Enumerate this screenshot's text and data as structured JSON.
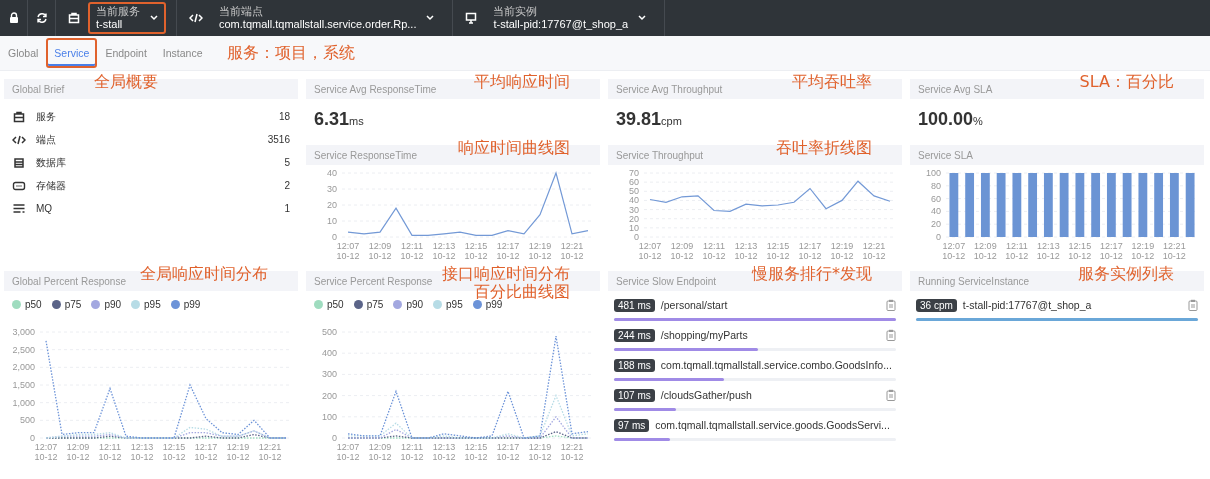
{
  "topbar": {
    "selectors": [
      {
        "kind": "service",
        "label": "当前服务",
        "value": "t-stall",
        "highlighted": true
      },
      {
        "kind": "endpoint",
        "label": "当前端点",
        "value": "com.tqmall.tqmallstall.service.order.Rp...",
        "highlighted": false
      },
      {
        "kind": "instance",
        "label": "当前实例",
        "value": "t-stall-pid:17767@t_shop_a",
        "highlighted": false
      }
    ]
  },
  "tabs": [
    {
      "label": "Global",
      "selected": false,
      "highlighted": false
    },
    {
      "label": "Service",
      "selected": true,
      "highlighted": true
    },
    {
      "label": "Endpoint",
      "selected": false,
      "highlighted": false
    },
    {
      "label": "Instance",
      "selected": false,
      "highlighted": false
    }
  ],
  "tabs_annotation": "服务：项目，系统",
  "global_brief": {
    "title": "Global Brief",
    "annotation": "全局概要",
    "items": [
      {
        "kind": "service",
        "label": "服务",
        "count": "18"
      },
      {
        "kind": "endpoint",
        "label": "端点",
        "count": "3516"
      },
      {
        "kind": "database",
        "label": "数据库",
        "count": "5"
      },
      {
        "kind": "cache",
        "label": "存储器",
        "count": "2"
      },
      {
        "kind": "mq",
        "label": "MQ",
        "count": "1"
      }
    ]
  },
  "metrics": [
    {
      "title": "Service Avg ResponseTime",
      "annotation": "平均响应时间",
      "value": "6.31",
      "unit": "ms"
    },
    {
      "title": "Service Avg Throughput",
      "annotation": "平均吞吐率",
      "value": "39.81",
      "unit": "cpm"
    },
    {
      "title": "Service Avg SLA",
      "annotation": "SLA：百分比",
      "value": "100.00",
      "unit": "%"
    }
  ],
  "trend_charts": [
    {
      "title": "Service ResponseTime",
      "annotation": "响应时间曲线图",
      "chart_data": {
        "type": "line",
        "categories": [
          "12:07 10-12",
          null,
          "12:09 10-12",
          null,
          "12:11 10-12",
          null,
          "12:13 10-12",
          null,
          "12:15 10-12",
          null,
          "12:17 10-12",
          null,
          "12:19 10-12",
          null,
          "12:21 10-12",
          null
        ],
        "values": [
          3,
          2,
          3,
          18,
          1,
          1,
          2,
          3,
          1,
          1,
          4,
          2,
          14,
          40,
          2,
          4
        ],
        "ylim": [
          0,
          40
        ],
        "yticks": [
          0,
          10,
          20,
          30,
          40
        ],
        "grid": true
      }
    },
    {
      "title": "Service Throughput",
      "annotation": "吞吐率折线图",
      "chart_data": {
        "type": "line",
        "categories": [
          "12:07 10-12",
          null,
          "12:09 10-12",
          null,
          "12:11 10-12",
          null,
          "12:13 10-12",
          null,
          "12:15 10-12",
          null,
          "12:17 10-12",
          null,
          "12:19 10-12",
          null,
          "12:21 10-12",
          null
        ],
        "values": [
          41,
          38,
          44,
          45,
          29,
          28,
          36,
          34,
          35,
          38,
          53,
          31,
          40,
          61,
          45,
          39
        ],
        "ylim": [
          0,
          70
        ],
        "yticks": [
          0,
          10,
          20,
          30,
          40,
          50,
          60,
          70
        ],
        "grid": true
      }
    },
    {
      "title": "Service SLA",
      "chart_data": {
        "type": "bar",
        "categories": [
          "12:07 10-12",
          null,
          "12:09 10-12",
          null,
          "12:11 10-12",
          null,
          "12:13 10-12",
          null,
          "12:15 10-12",
          null,
          "12:17 10-12",
          null,
          "12:19 10-12",
          null,
          "12:21 10-12",
          null
        ],
        "values": [
          100,
          100,
          100,
          100,
          100,
          100,
          100,
          100,
          100,
          100,
          100,
          100,
          100,
          100,
          100,
          100
        ],
        "ylim": [
          0,
          100
        ],
        "yticks": [
          0,
          20,
          40,
          60,
          80,
          100
        ],
        "grid": true
      }
    }
  ],
  "percent_charts": [
    {
      "title": "Global Percent Response",
      "annotation": "全局响应时间分布",
      "chart_data": {
        "type": "line",
        "categories": [
          "12:07 10-12",
          null,
          "12:09 10-12",
          null,
          "12:11 10-12",
          null,
          "12:13 10-12",
          null,
          "12:15 10-12",
          null,
          "12:17 10-12",
          null,
          "12:19 10-12",
          null,
          "12:21 10-12",
          null
        ],
        "series": [
          {
            "name": "p50",
            "color": "#9fdcbf",
            "line_style": "dotted",
            "values": [
              0,
              0,
              0,
              0,
              0,
              0,
              0,
              0,
              0,
              0,
              0,
              0,
              0,
              0,
              0,
              0
            ]
          },
          {
            "name": "p75",
            "color": "#5b6488",
            "line_style": "dotted",
            "values": [
              0,
              0,
              0,
              0,
              50,
              0,
              0,
              0,
              0,
              0,
              50,
              0,
              0,
              100,
              0,
              0
            ]
          },
          {
            "name": "p90",
            "color": "#a3a8e0",
            "line_style": "dotted",
            "values": [
              0,
              50,
              50,
              50,
              100,
              0,
              0,
              0,
              0,
              150,
              150,
              50,
              50,
              200,
              0,
              0
            ]
          },
          {
            "name": "p95",
            "color": "#b7dce6",
            "line_style": "dotted",
            "values": [
              0,
              50,
              100,
              100,
              150,
              0,
              0,
              0,
              0,
              300,
              250,
              50,
              50,
              200,
              0,
              0
            ]
          },
          {
            "name": "p99",
            "color": "#6c93d8",
            "line_style": "dotted",
            "values": [
              2750,
              100,
              150,
              150,
              1400,
              50,
              0,
              0,
              0,
              1500,
              550,
              150,
              100,
              500,
              0,
              0
            ]
          }
        ],
        "ylim": [
          0,
          3000
        ],
        "yticks": [
          0,
          500,
          {
            "value": 1000,
            "label": "1,000"
          },
          {
            "value": 1500,
            "label": "1,500"
          },
          {
            "value": 2000,
            "label": "2,000"
          },
          {
            "value": 2500,
            "label": "2,500"
          },
          {
            "value": 3000,
            "label": "3,000"
          }
        ],
        "grid": true
      }
    },
    {
      "title": "Service Percent Response",
      "annotation": "接口响应时间分布百分比曲线图",
      "chart_data": {
        "type": "line",
        "categories": [
          "12:07 10-12",
          null,
          "12:09 10-12",
          null,
          "12:11 10-12",
          null,
          "12:13 10-12",
          null,
          "12:15 10-12",
          null,
          "12:17 10-12",
          null,
          "12:19 10-12",
          null,
          "12:21 10-12",
          null
        ],
        "series": [
          {
            "name": "p50",
            "color": "#9fdcbf",
            "line_style": "dotted",
            "values": [
              0,
              0,
              0,
              0,
              0,
              0,
              0,
              0,
              0,
              0,
              0,
              0,
              0,
              10,
              0,
              0
            ]
          },
          {
            "name": "p75",
            "color": "#5b6488",
            "line_style": "dotted",
            "values": [
              0,
              0,
              0,
              10,
              0,
              0,
              0,
              0,
              0,
              0,
              0,
              0,
              0,
              30,
              0,
              0
            ]
          },
          {
            "name": "p90",
            "color": "#a3a8e0",
            "line_style": "dotted",
            "values": [
              0,
              0,
              0,
              40,
              0,
              0,
              0,
              0,
              0,
              0,
              10,
              0,
              0,
              100,
              0,
              0
            ]
          },
          {
            "name": "p95",
            "color": "#b7dce6",
            "line_style": "dotted",
            "values": [
              10,
              10,
              10,
              70,
              0,
              0,
              10,
              0,
              0,
              0,
              20,
              0,
              10,
              200,
              10,
              20
            ]
          },
          {
            "name": "p99",
            "color": "#6c93d8",
            "line_style": "dotted",
            "values": [
              20,
              10,
              10,
              220,
              0,
              0,
              20,
              10,
              0,
              10,
              220,
              0,
              10,
              480,
              20,
              30
            ]
          }
        ],
        "ylim": [
          0,
          500
        ],
        "yticks": [
          0,
          100,
          200,
          300,
          400,
          500
        ],
        "grid": true
      }
    }
  ],
  "slow_endpoints": {
    "title": "Service Slow Endpoint",
    "annotation": "慢服务排行*发现",
    "items": [
      {
        "latency": "481 ms",
        "name": "/personal/start",
        "level": 1.0
      },
      {
        "latency": "244 ms",
        "name": "/shopping/myParts",
        "level": 0.51
      },
      {
        "latency": "188 ms",
        "name": "com.tqmall.tqmallstall.service.combo.GoodsInfo...",
        "level": 0.39
      },
      {
        "latency": "107 ms",
        "name": "/cloudsGather/push",
        "level": 0.22
      },
      {
        "latency": "97 ms",
        "name": "com.tqmall.tqmallstall.service.goods.GoodsServi...",
        "level": 0.2
      }
    ]
  },
  "instances": {
    "title": "Running ServiceInstance",
    "annotation": "服务实例列表",
    "items": [
      {
        "throughput": "36 cpm",
        "name": "t-stall-pid:17767@t_shop_a",
        "level": 1.0
      }
    ]
  }
}
